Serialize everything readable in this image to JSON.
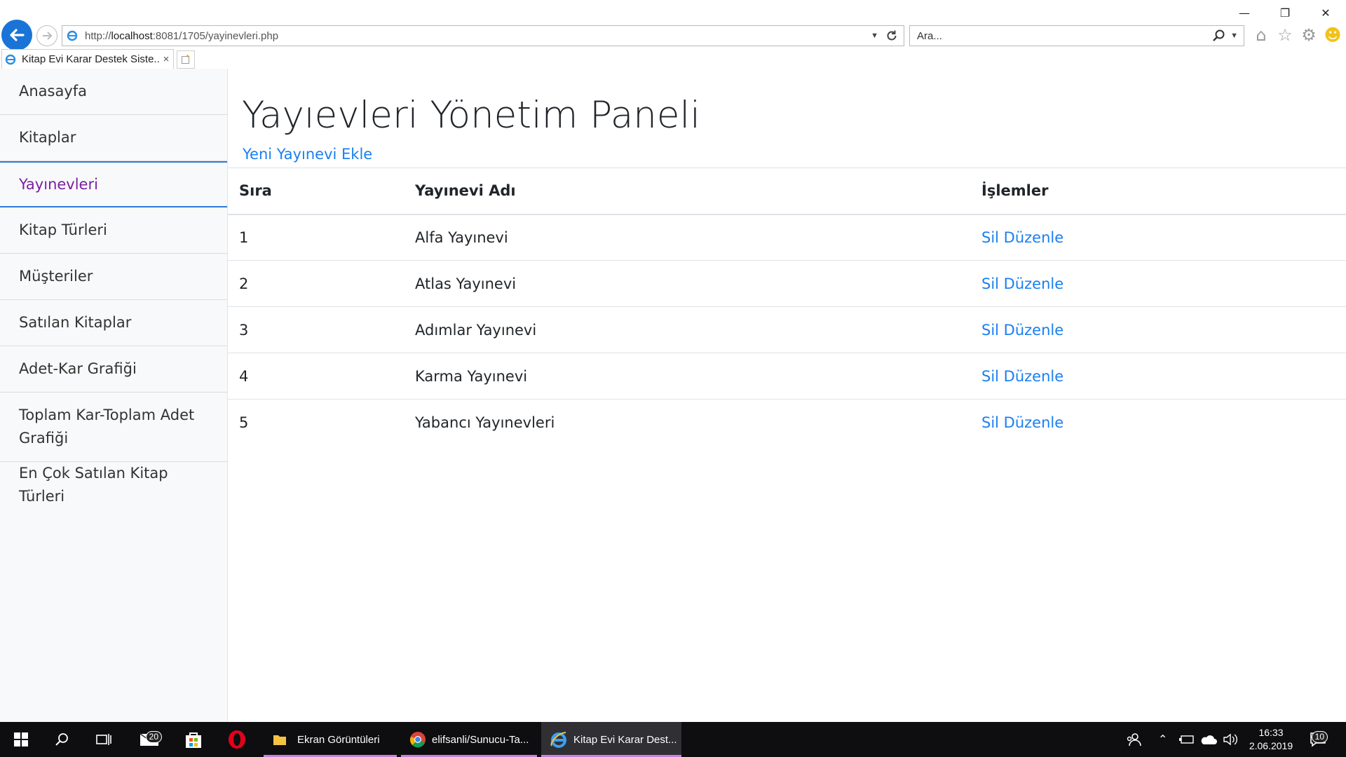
{
  "browser": {
    "url_prefix": "http://",
    "url_host": "localhost",
    "url_rest": ":8081/1705/yayinevleri.php",
    "search_placeholder": "Ara...",
    "tab_title": "Kitap Evi Karar Destek Siste...",
    "tab_close": "×"
  },
  "sidebar": {
    "items": [
      {
        "label": "Anasayfa"
      },
      {
        "label": "Kitaplar"
      },
      {
        "label": "Yayınevleri",
        "active": true
      },
      {
        "label": "Kitap Türleri"
      },
      {
        "label": "Müşteriler"
      },
      {
        "label": "Satılan Kitaplar"
      },
      {
        "label": "Adet-Kar Grafiği"
      },
      {
        "label": "Toplam Kar-Toplam Adet Grafiği"
      },
      {
        "label": "En Çok Satılan Kitap Türleri"
      }
    ]
  },
  "main": {
    "title": "Yayıevleri Yönetim Paneli",
    "add_link": "Yeni Yayınevi Ekle",
    "table": {
      "headers": [
        "Sıra",
        "Yayınevi Adı",
        "İşlemler"
      ],
      "rows": [
        {
          "no": "1",
          "name": "Alfa Yayınevi",
          "actions": "Sil Düzenle"
        },
        {
          "no": "2",
          "name": "Atlas Yayınevi",
          "actions": "Sil Düzenle"
        },
        {
          "no": "3",
          "name": "Adımlar Yayınevi",
          "actions": "Sil Düzenle"
        },
        {
          "no": "4",
          "name": "Karma Yayınevi",
          "actions": "Sil Düzenle"
        },
        {
          "no": "5",
          "name": "Yabancı Yayınevleri",
          "actions": "Sil Düzenle"
        }
      ]
    }
  },
  "taskbar": {
    "mail_badge": "20",
    "apps": [
      {
        "label": "Ekran Görüntüleri"
      },
      {
        "label": "elifsanli/Sunucu-Ta..."
      },
      {
        "label": "Kitap Evi Karar Dest..."
      }
    ],
    "time": "16:33",
    "date": "2.06.2019",
    "notif_badge": "10"
  },
  "colors": {
    "link": "#1a7ff0",
    "active_nav": "#7b1fa2",
    "accent_border": "#2f7bd6"
  }
}
